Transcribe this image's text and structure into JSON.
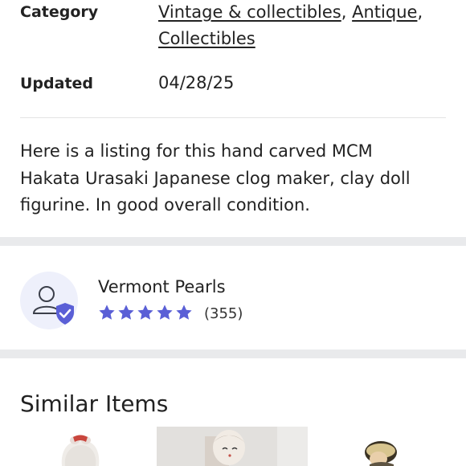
{
  "details": {
    "category_label": "Category",
    "categories": [
      "Vintage & collectibles",
      "Antique",
      "Collectibles"
    ],
    "separator": ",",
    "updated_label": "Updated",
    "updated_value": "04/28/25"
  },
  "description": {
    "line1": "Here is a listing for this hand carved MCM",
    "line2": "Hakata Urasaki Japanese clog maker, clay doll",
    "line3": "figurine. In good overall condition."
  },
  "seller": {
    "name": "Vermont Pearls",
    "rating_stars": 5,
    "review_count": "(355)",
    "icon": "verified-user-icon"
  },
  "similar": {
    "title": "Similar Items"
  },
  "colors": {
    "accent": "#5a5fd6",
    "avatar_bg": "#eef0fb",
    "section_gap": "#e9eaec"
  }
}
